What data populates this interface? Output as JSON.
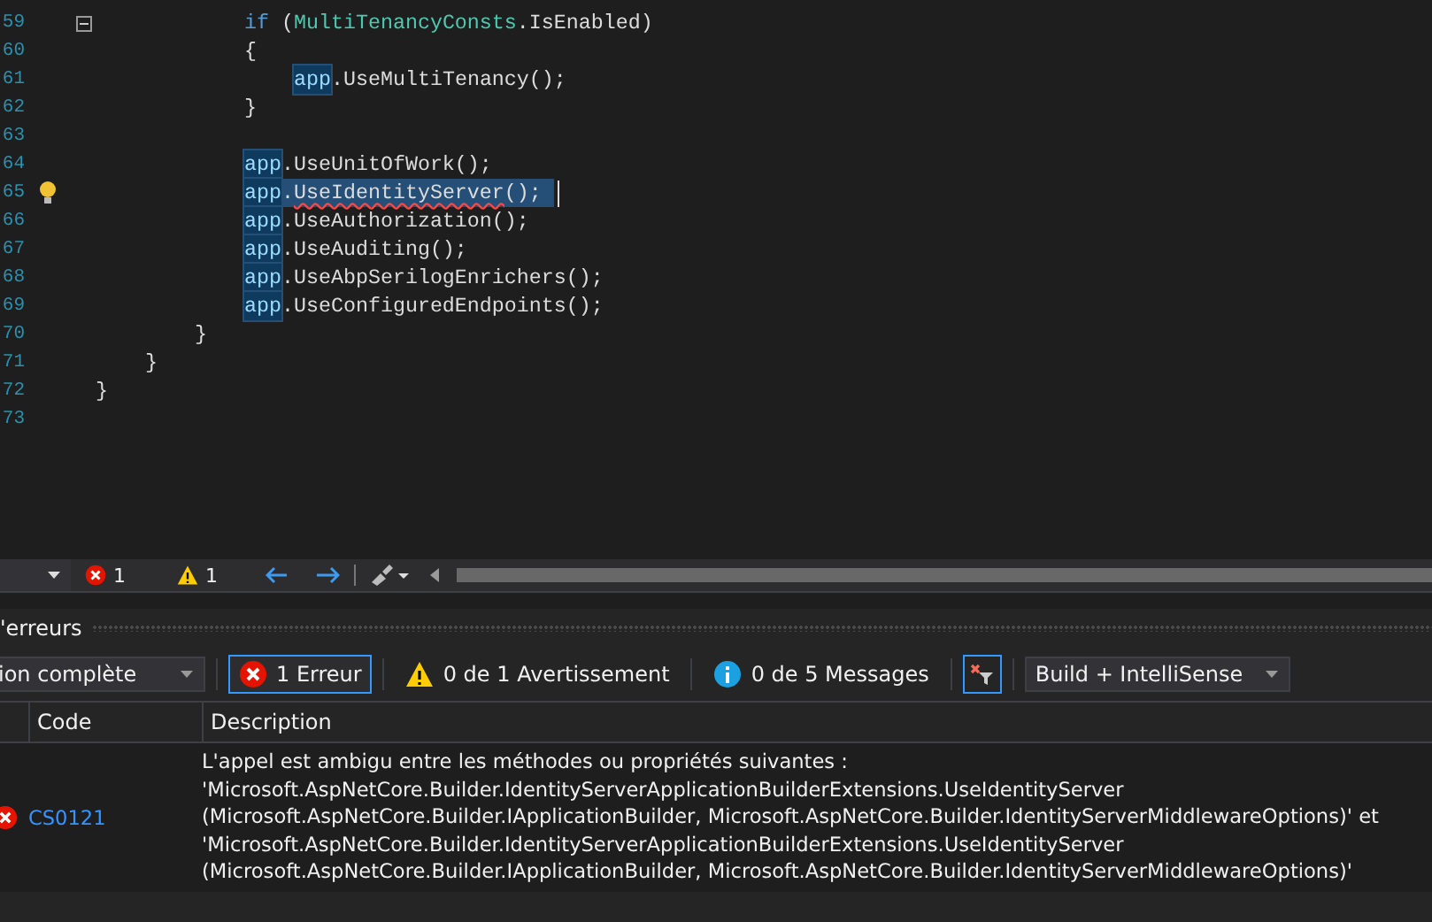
{
  "editor": {
    "lines": [
      {
        "number": "59",
        "kind": "body",
        "lightbulb": false,
        "collapse": true,
        "segments": [
          {
            "text": "if",
            "kind": "keyword"
          },
          {
            "text": " (",
            "kind": "plain"
          },
          {
            "text": "MultiTenancyConsts",
            "kind": "type"
          },
          {
            "text": ".IsEnabled)",
            "kind": "plain"
          }
        ]
      },
      {
        "number": "60",
        "kind": "body",
        "lightbulb": false,
        "collapse": false,
        "segments": [
          {
            "text": "{",
            "kind": "plain"
          }
        ]
      },
      {
        "number": "61",
        "kind": "inner",
        "lightbulb": false,
        "collapse": false,
        "segments": [
          {
            "text": "app",
            "kind": "reference"
          },
          {
            "text": ".UseMultiTenancy();",
            "kind": "plain"
          }
        ]
      },
      {
        "number": "62",
        "kind": "body",
        "lightbulb": false,
        "collapse": false,
        "segments": [
          {
            "text": "}",
            "kind": "plain"
          }
        ]
      },
      {
        "number": "63",
        "lightbulb": false,
        "collapse": false
      },
      {
        "number": "64",
        "kind": "body",
        "lightbulb": false,
        "collapse": false,
        "segments": [
          {
            "text": "app",
            "kind": "reference"
          },
          {
            "text": ".UseUnitOfWork();",
            "kind": "plain"
          }
        ]
      },
      {
        "number": "65",
        "kind": "body",
        "lightbulb": true,
        "collapse": false,
        "segments": [
          {
            "text": "app",
            "kind": "reference"
          },
          {
            "text": ".",
            "kind": "selected"
          },
          {
            "text": "UseIdentityServer",
            "kind": "selected-error"
          },
          {
            "text": "();",
            "kind": "selected"
          }
        ]
      },
      {
        "number": "66",
        "kind": "body",
        "lightbulb": false,
        "collapse": false,
        "segments": [
          {
            "text": "app",
            "kind": "reference"
          },
          {
            "text": ".UseAuthorization();",
            "kind": "plain"
          }
        ]
      },
      {
        "number": "67",
        "kind": "body",
        "lightbulb": false,
        "collapse": false,
        "segments": [
          {
            "text": "app",
            "kind": "reference"
          },
          {
            "text": ".UseAuditing();",
            "kind": "plain"
          }
        ]
      },
      {
        "number": "68",
        "kind": "body",
        "lightbulb": false,
        "collapse": false,
        "segments": [
          {
            "text": "app",
            "kind": "reference"
          },
          {
            "text": ".UseAbpSerilogEnrichers();",
            "kind": "plain"
          }
        ]
      },
      {
        "number": "69",
        "kind": "body",
        "lightbulb": false,
        "collapse": false,
        "segments": [
          {
            "text": "app",
            "kind": "reference"
          },
          {
            "text": ".UseConfiguredEndpoints();",
            "kind": "plain"
          }
        ]
      },
      {
        "number": "70",
        "kind": "method",
        "lightbulb": false,
        "collapse": false,
        "segments": [
          {
            "text": "}",
            "kind": "plain"
          }
        ]
      },
      {
        "number": "71",
        "kind": "class",
        "lightbulb": false,
        "collapse": false,
        "segments": [
          {
            "text": "}",
            "kind": "plain"
          }
        ]
      },
      {
        "number": "72",
        "kind": "namespace",
        "lightbulb": false,
        "collapse": false,
        "segments": [
          {
            "text": "}",
            "kind": "plain"
          }
        ]
      },
      {
        "number": "73",
        "lightbulb": false,
        "collapse": false
      }
    ]
  },
  "status_bar": {
    "errors": "1",
    "warnings": "1"
  },
  "error_list": {
    "title": "'erreurs",
    "scope": "ion complète",
    "filters": [
      {
        "kind": "error",
        "label": "1 Erreur",
        "selected": true
      },
      {
        "kind": "warning",
        "label": "0 de 1 Avertissement",
        "selected": false
      },
      {
        "kind": "info",
        "label": "0 de 5 Messages",
        "selected": false
      }
    ],
    "clear_filter_selected": true,
    "source": "Build + IntelliSense",
    "columns": [
      "Code",
      "Description"
    ],
    "rows": [
      {
        "code": "CS0121",
        "description": "L'appel est ambigu entre les méthodes ou propriétés suivantes :\n'Microsoft.AspNetCore.Builder.IdentityServerApplicationBuilderExtensions.UseIdentityServer\n(Microsoft.AspNetCore.Builder.IApplicationBuilder, Microsoft.AspNetCore.Builder.IdentityServerMiddlewareOptions)' et\n'Microsoft.AspNetCore.Builder.IdentityServerApplicationBuilderExtensions.UseIdentityServer\n(Microsoft.AspNetCore.Builder.IApplicationBuilder, Microsoft.AspNetCore.Builder.IdentityServerMiddlewareOptions)'"
      }
    ]
  }
}
